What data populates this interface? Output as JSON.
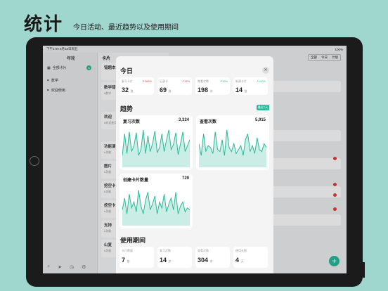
{
  "promo": {
    "title": "统计",
    "subtitle": "今日活动、最近趋势以及使用期间"
  },
  "status": {
    "time": "下午2:00",
    "date": "8月15日周五",
    "battery": "100%"
  },
  "sidebar": {
    "title": "年轮",
    "items": [
      {
        "label": "全部卡片",
        "count": "8",
        "icon": "stack-icon"
      },
      {
        "label": "数学",
        "icon": "tag-icon"
      },
      {
        "label": "欢迎使用",
        "icon": "tag-icon"
      }
    ]
  },
  "middle": {
    "title": "卡片",
    "cards": [
      {
        "title": "错题本",
        "sub": ""
      },
      {
        "title": "数学错",
        "sub": "#数学"
      },
      {
        "title": "欢迎",
        "sub": "#欢迎使用"
      },
      {
        "title": "功能演",
        "sub": "#功能"
      },
      {
        "title": "图片",
        "sub": "#功能"
      },
      {
        "title": "挖空卡",
        "sub": "#功能"
      },
      {
        "title": "挖空卡",
        "sub": "#功能"
      },
      {
        "title": "支持",
        "sub": "#功能"
      },
      {
        "title": "山复",
        "sub": "#功能"
      }
    ]
  },
  "right": {
    "segments": [
      "全部",
      "今日",
      "计划"
    ]
  },
  "modal": {
    "today_title": "今日",
    "close_icon": "close-icon",
    "today": [
      {
        "label": "复习卡片",
        "value": "32",
        "unit": "张",
        "change": "↗166%",
        "dir": "down"
      },
      {
        "label": "记录卡",
        "value": "69",
        "unit": "张",
        "change": "↗13%",
        "dir": "down"
      },
      {
        "label": "查看次数",
        "value": "198",
        "unit": "次",
        "change": "↗19%",
        "dir": "up"
      },
      {
        "label": "新建卡片",
        "value": "14",
        "unit": "张",
        "change": "↗100%",
        "dir": "up"
      }
    ],
    "trend_title": "趋势",
    "trend_badge": "最近7天",
    "charts": [
      {
        "title": "复习次数",
        "value": "3,324",
        "color": "#2bb99a",
        "values": [
          30,
          85,
          35,
          90,
          40,
          55,
          88,
          30,
          45,
          95,
          35,
          80,
          40,
          60,
          92,
          38,
          50,
          85,
          40,
          70,
          95,
          45,
          58,
          88,
          32,
          60,
          90,
          40,
          55,
          70
        ]
      },
      {
        "title": "查看次数",
        "value": "5,915",
        "color": "#2bb99a",
        "values": [
          60,
          30,
          85,
          40,
          55,
          50,
          35,
          90,
          45,
          40,
          70,
          30,
          95,
          50,
          40,
          60,
          35,
          45,
          55,
          30,
          70,
          85,
          40,
          55,
          35,
          75,
          45,
          40,
          60,
          50
        ]
      },
      {
        "title": "创建卡片数量",
        "value": "729",
        "color": "#2bb99a",
        "values": [
          40,
          70,
          30,
          80,
          45,
          60,
          35,
          90,
          50,
          30,
          65,
          85,
          40,
          55,
          75,
          30,
          60,
          45,
          80,
          35,
          55,
          70,
          40,
          85,
          30,
          50,
          60,
          35,
          45,
          40
        ]
      }
    ],
    "usage_title": "使用期间",
    "usage": [
      {
        "label": "卡片数量",
        "value": "7",
        "unit": "张"
      },
      {
        "label": "复习次数",
        "value": "14",
        "unit": "次"
      },
      {
        "label": "查看次数",
        "value": "304",
        "unit": "次"
      },
      {
        "label": "使用天数",
        "value": "4",
        "unit": "天"
      }
    ]
  }
}
